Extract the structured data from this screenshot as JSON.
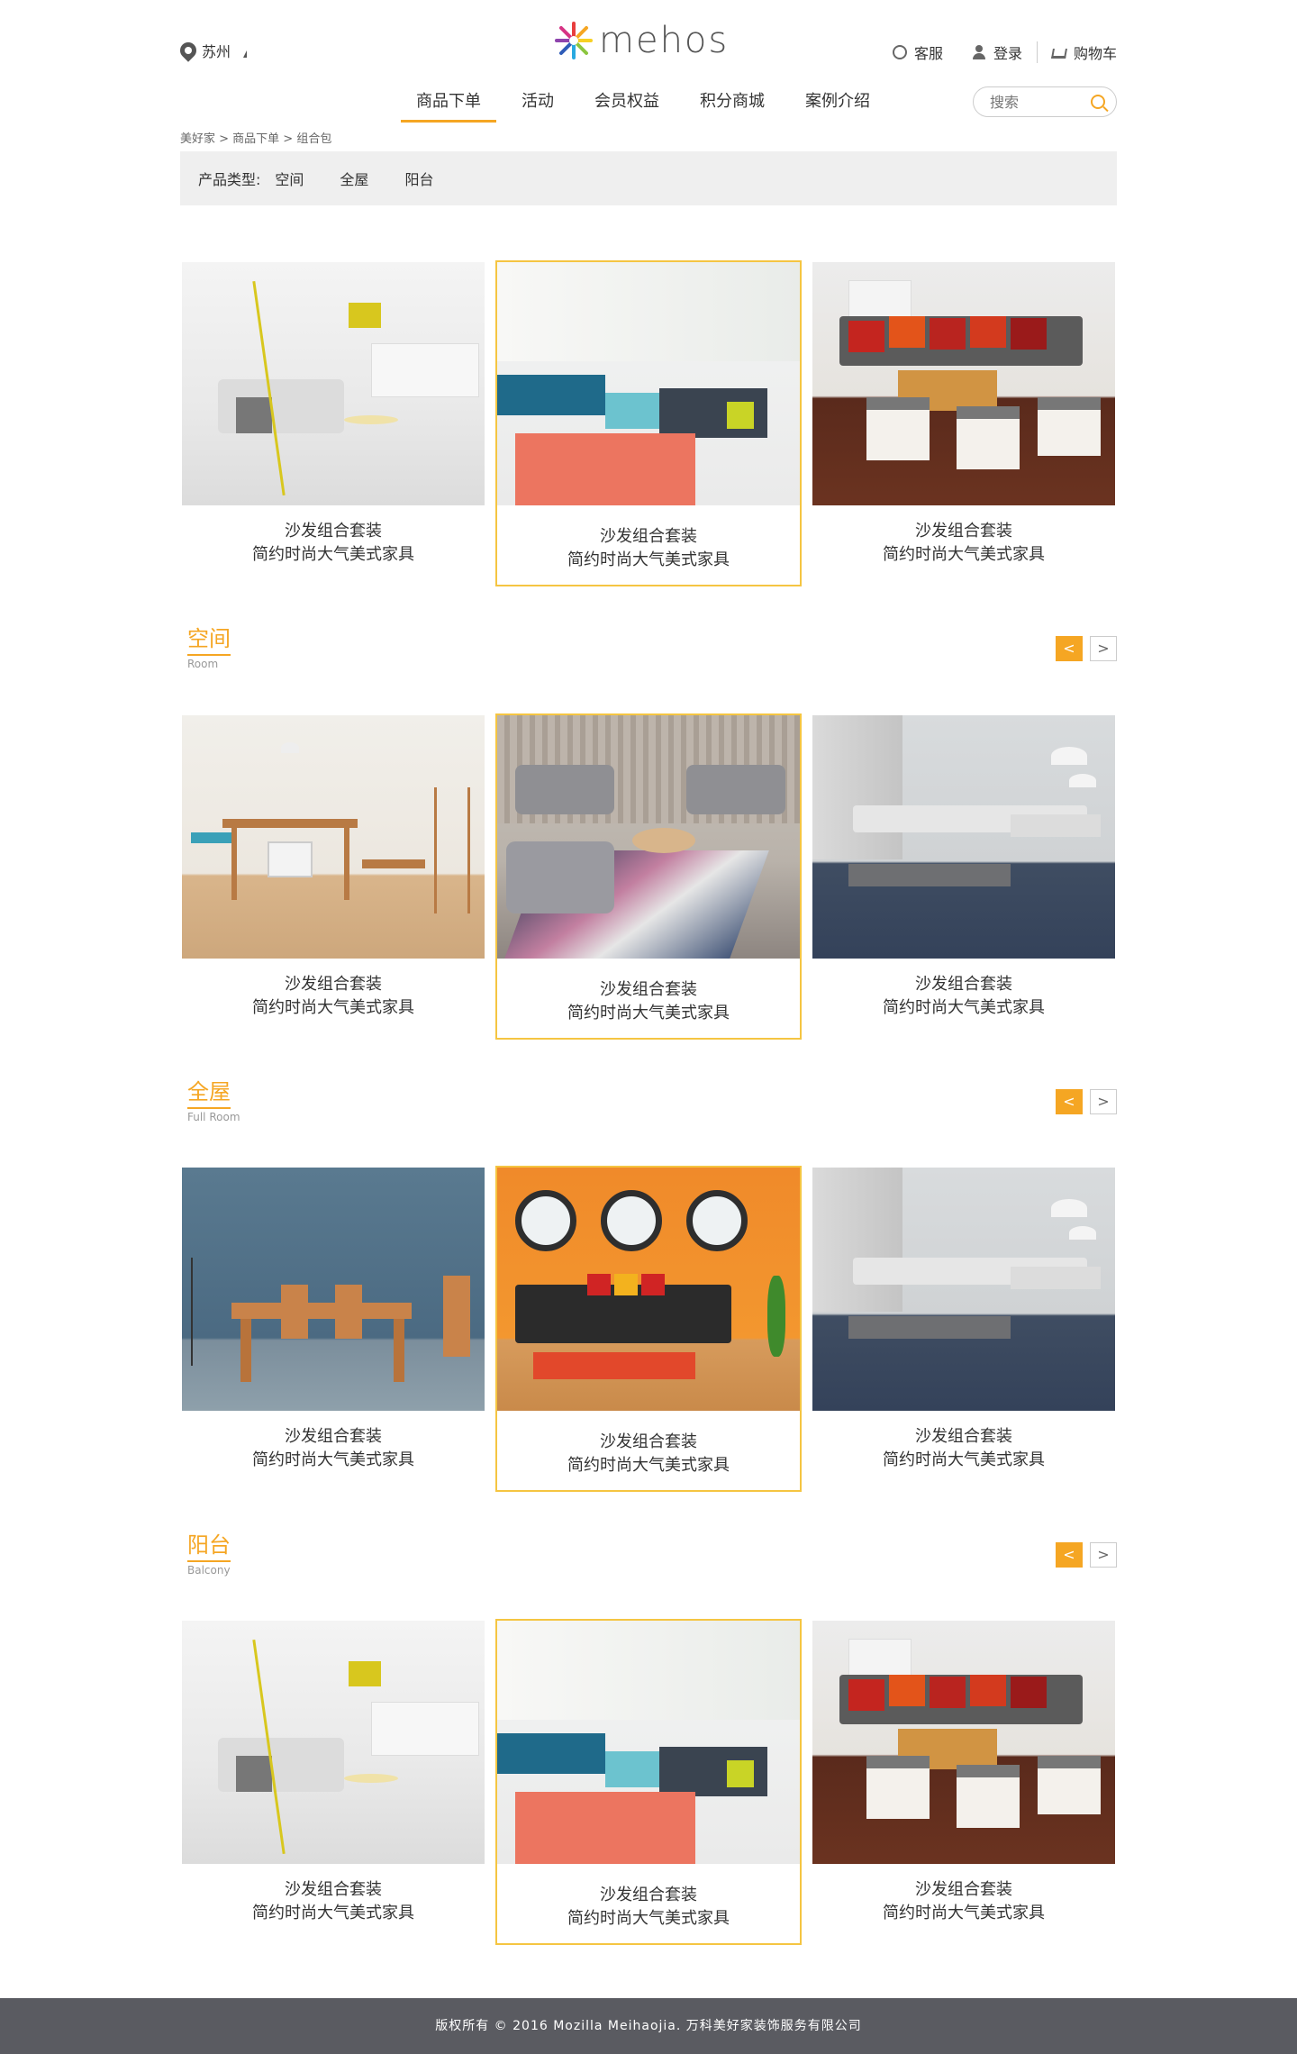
{
  "header": {
    "city": "苏州",
    "logo_text": "mehos",
    "links": {
      "service": "客服",
      "login": "登录",
      "cart": "购物车"
    }
  },
  "nav": {
    "items": [
      "商品下单",
      "活动",
      "会员权益",
      "积分商城",
      "案例介绍"
    ],
    "active_index": 0,
    "search_placeholder": "搜索"
  },
  "breadcrumb": "美好家 > 商品下单 > 组合包",
  "filter": {
    "label": "产品类型:",
    "options": [
      "空间",
      "全屋",
      "阳台"
    ]
  },
  "card_text": {
    "line1": "沙发组合套装",
    "line2": "简约时尚大气美式家具"
  },
  "sections": [
    {
      "title": "空间",
      "subtitle": "Room"
    },
    {
      "title": "全屋",
      "subtitle": "Full Room"
    },
    {
      "title": "阳台",
      "subtitle": "Balcony"
    }
  ],
  "arrows": {
    "prev": "<",
    "next": ">"
  },
  "colors": {
    "accent": "#f5a623",
    "footer_bg": "#5a5b61",
    "filter_bg": "#efefef"
  },
  "footer": "版权所有 © 2016 Mozilla Meihaojia. 万科美好家装饰服务有限公司"
}
